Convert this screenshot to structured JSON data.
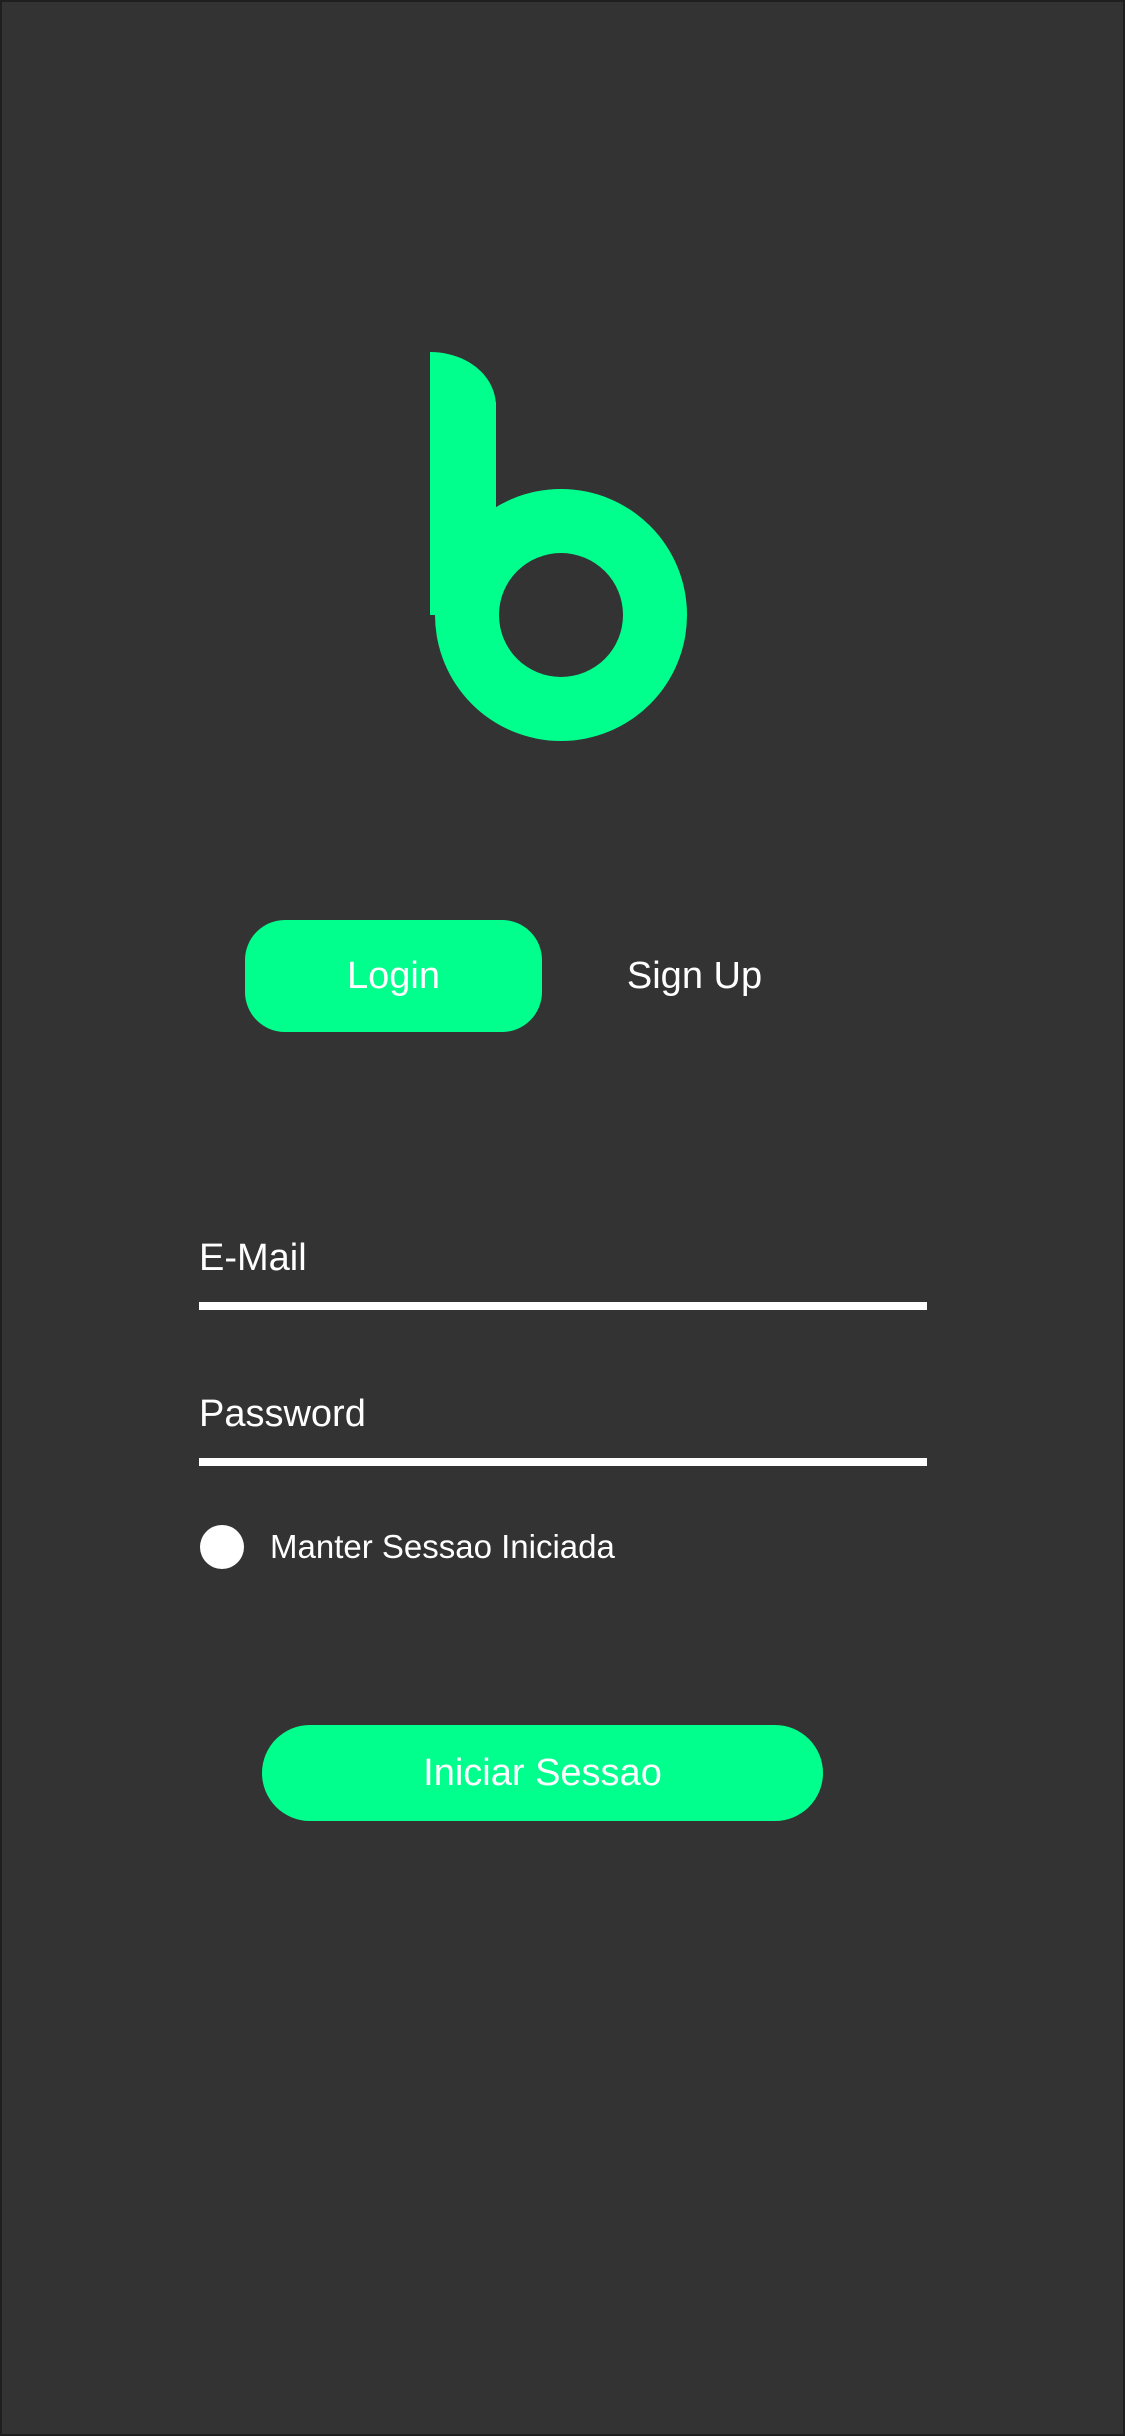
{
  "colors": {
    "background": "#333333",
    "accent": "#00ff8c",
    "text": "#ffffff"
  },
  "logo": {
    "icon": "b-logo-icon"
  },
  "tabs": {
    "login_label": "Login",
    "signup_label": "Sign Up",
    "active": "Login"
  },
  "form": {
    "email_placeholder": "E-Mail",
    "email_value": "",
    "password_placeholder": "Password",
    "password_value": "",
    "remember_label": "Manter Sessao Iniciada",
    "remember_checked": false
  },
  "submit": {
    "label": "Iniciar Sessao"
  }
}
